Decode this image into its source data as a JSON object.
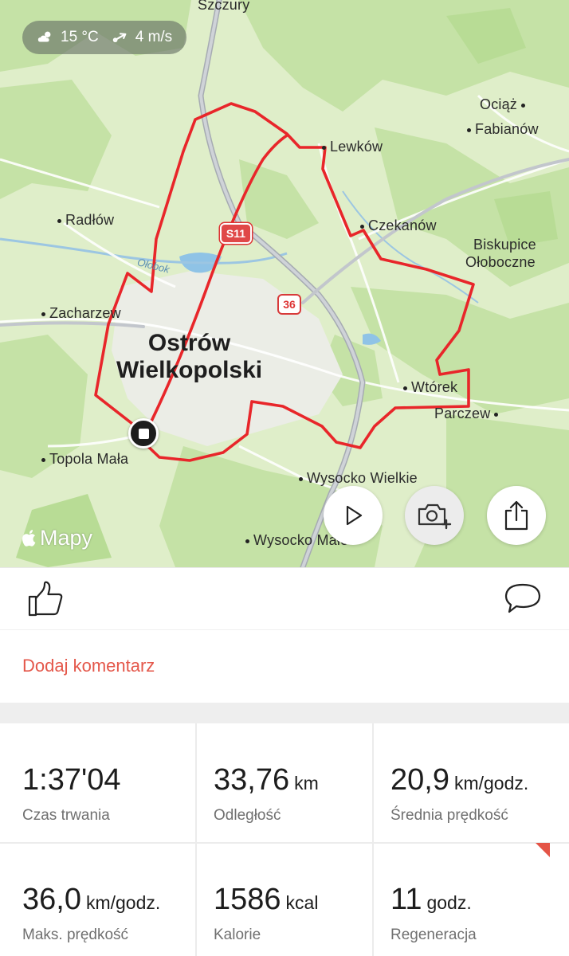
{
  "weather": {
    "temperature": "15 °C",
    "wind": "4 m/s",
    "icon": "cloud-sun-icon",
    "wind_icon": "wind-arrow-icon"
  },
  "map": {
    "attribution": "Mapy",
    "city": [
      "Ostrów",
      "Wielkopolski"
    ],
    "river": "Ołobok",
    "roads": [
      "S11",
      "36"
    ],
    "places": {
      "szczury": "Szczury",
      "ociaz": "Ociąż",
      "fabianow": "Fabianów",
      "lewkow": "Lewków",
      "radlow": "Radłów",
      "czekanow": "Czekanów",
      "biskupice": "Biskupice",
      "oloboczne": "Ołoboczne",
      "zacharzew": "Zacharzew",
      "wtorek": "Wtórek",
      "parczew": "Parczew",
      "topola": "Topola Mała",
      "wysocko_wielkie": "Wysocko Wielkie",
      "wysocko_male": "Wysocko Małe"
    },
    "route_color": "#e8262a"
  },
  "actions": {
    "play_icon": "play-icon",
    "camera_icon": "camera-add-icon",
    "share_icon": "share-icon"
  },
  "social": {
    "like_icon": "thumbs-up-icon",
    "comment_icon": "comment-bubble-icon",
    "add_comment": "Dodaj komentarz"
  },
  "stats": [
    {
      "value": "1:37'04",
      "unit": "",
      "label": "Czas trwania"
    },
    {
      "value": "33,76",
      "unit": "km",
      "label": "Odległość"
    },
    {
      "value": "20,9",
      "unit": "km/godz.",
      "label": "Średnia prędkość"
    },
    {
      "value": "36,0",
      "unit": "km/godz.",
      "label": "Maks. prędkość"
    },
    {
      "value": "1586",
      "unit": "kcal",
      "label": "Kalorie"
    },
    {
      "value": "11",
      "unit": "godz.",
      "label": "Regeneracja"
    }
  ],
  "colors": {
    "accent": "#e4574a",
    "route": "#e8262a",
    "map_green": "#cfe6b0"
  }
}
